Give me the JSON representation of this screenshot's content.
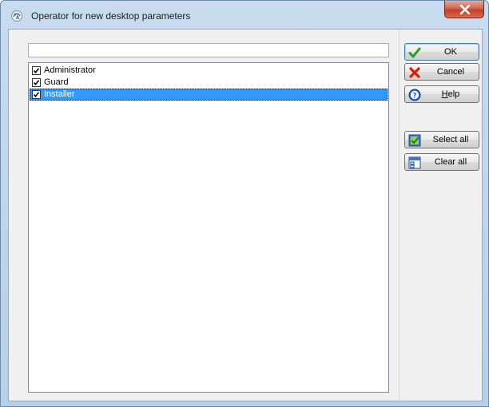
{
  "window": {
    "title": "Operator for new desktop parameters"
  },
  "filter": {
    "value": "",
    "placeholder": ""
  },
  "operators": [
    {
      "label": "Administrator",
      "checked": true,
      "selected": false
    },
    {
      "label": "Guard",
      "checked": true,
      "selected": false
    },
    {
      "label": "Installer",
      "checked": true,
      "selected": true
    }
  ],
  "buttons": {
    "ok": "OK",
    "cancel": "Cancel",
    "help_prefix": "",
    "help_mnemonic": "H",
    "help_rest": "elp",
    "select_all": "Select all",
    "clear_all": "Clear all"
  },
  "icons": {
    "ok": "check-icon",
    "cancel": "x-icon",
    "help": "question-icon",
    "select_all": "select-all-icon",
    "clear_all": "clear-all-icon",
    "app": "app-icon",
    "close": "close-icon"
  },
  "colors": {
    "selection": "#3399ff",
    "ok_check": "#21a121",
    "cancel_x": "#d81e05",
    "help_blue": "#2a5cc7",
    "close_red": "#c2402a"
  }
}
